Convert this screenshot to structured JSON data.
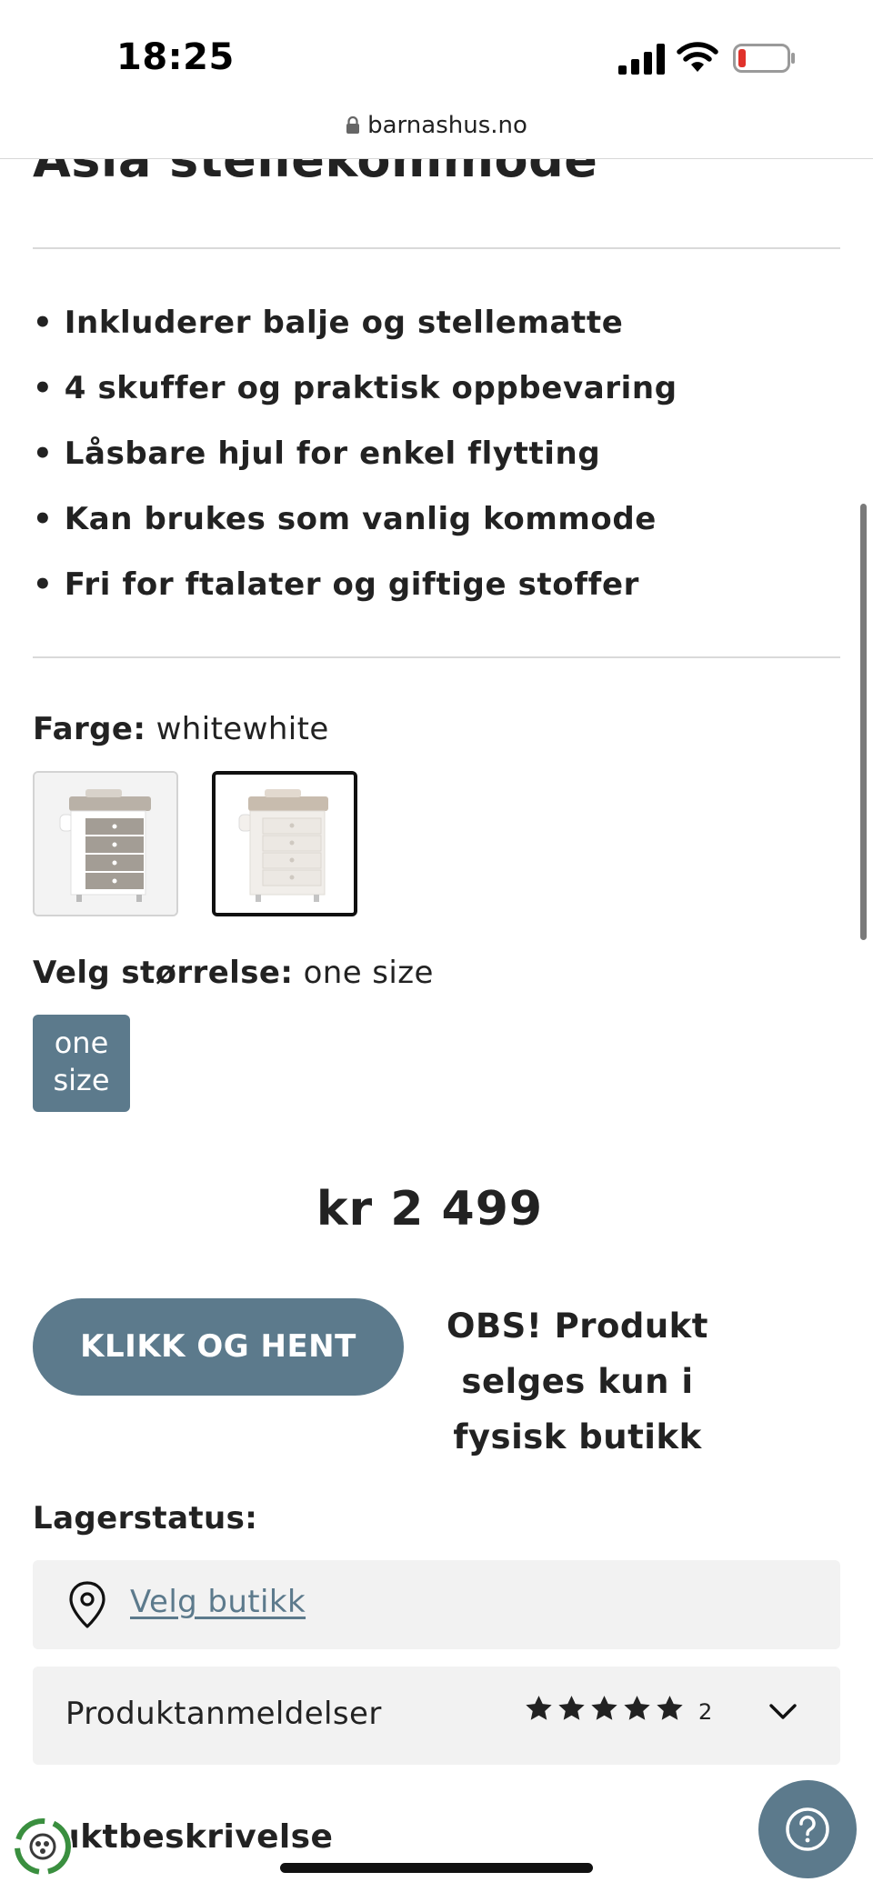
{
  "status_bar": {
    "time": "18:25",
    "battery_color": "#e0322b"
  },
  "browser": {
    "url": "barnashus.no"
  },
  "product": {
    "title": "Asia stellekommode",
    "features": [
      "• Inkluderer balje og stellematte",
      "• 4 skuffer og praktisk oppbevaring",
      "• Låsbare hjul for enkel flytting",
      "• Kan brukes som vanlig kommode",
      "• Fri for ftalater og giftige stoffer"
    ],
    "color": {
      "label": "Farge:",
      "value": "whitewhite",
      "selected_index": 1
    },
    "size": {
      "label": "Velg størrelse:",
      "value": "one size",
      "button_line1": "one",
      "button_line2": "size"
    },
    "price": "kr 2 499",
    "cta_label": "KLIKK OG HENT",
    "obs_note": [
      "OBS! Produkt",
      "selges kun i",
      "fysisk butikk"
    ],
    "stock_label": "Lagerstatus:",
    "store_link": "Velg butikk",
    "reviews": {
      "label": "Produktanmeldelser",
      "rating": 5,
      "max_rating": 5,
      "count": "2"
    },
    "description_heading": "duktbeskrivelse"
  },
  "colors": {
    "accent": "#5c7a8c",
    "text": "#222222",
    "panel": "#f2f2f2"
  }
}
